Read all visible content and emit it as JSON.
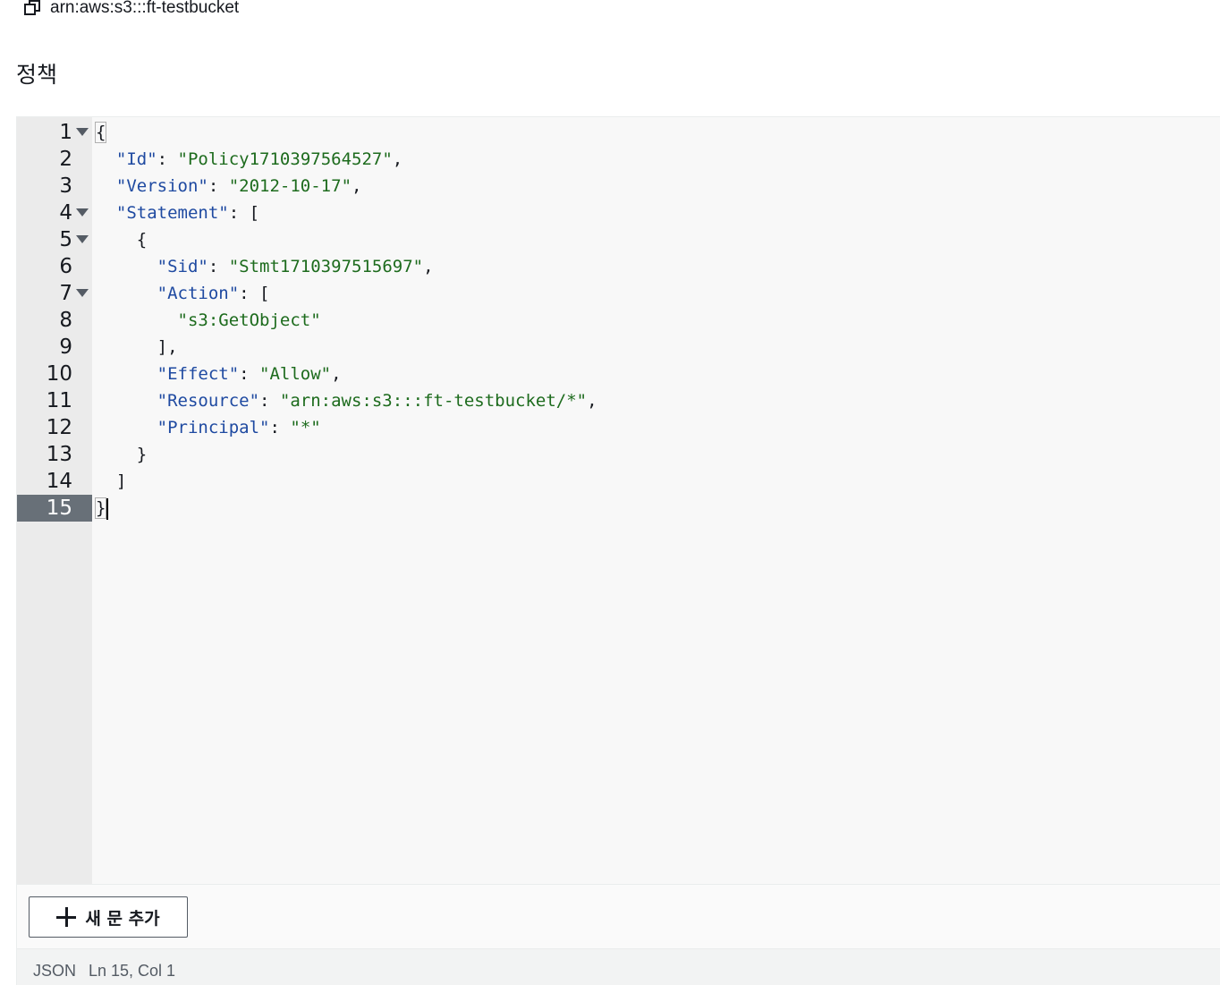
{
  "header": {
    "arn": "arn:aws:s3:::ft-testbucket",
    "copy_icon": "copy-icon"
  },
  "section": {
    "title": "정책"
  },
  "editor": {
    "active_line": 15,
    "fold_lines": [
      1,
      4,
      5,
      7
    ],
    "lines": [
      {
        "n": "1",
        "tokens": [
          {
            "t": "p",
            "v": "{"
          }
        ]
      },
      {
        "n": "2",
        "tokens": [
          {
            "t": "p",
            "v": "  "
          },
          {
            "t": "k",
            "v": "\"Id\""
          },
          {
            "t": "p",
            "v": ": "
          },
          {
            "t": "s",
            "v": "\"Policy1710397564527\""
          },
          {
            "t": "p",
            "v": ","
          }
        ]
      },
      {
        "n": "3",
        "tokens": [
          {
            "t": "p",
            "v": "  "
          },
          {
            "t": "k",
            "v": "\"Version\""
          },
          {
            "t": "p",
            "v": ": "
          },
          {
            "t": "s",
            "v": "\"2012-10-17\""
          },
          {
            "t": "p",
            "v": ","
          }
        ]
      },
      {
        "n": "4",
        "tokens": [
          {
            "t": "p",
            "v": "  "
          },
          {
            "t": "k",
            "v": "\"Statement\""
          },
          {
            "t": "p",
            "v": ": ["
          }
        ]
      },
      {
        "n": "5",
        "tokens": [
          {
            "t": "p",
            "v": "    {"
          }
        ]
      },
      {
        "n": "6",
        "tokens": [
          {
            "t": "p",
            "v": "      "
          },
          {
            "t": "k",
            "v": "\"Sid\""
          },
          {
            "t": "p",
            "v": ": "
          },
          {
            "t": "s",
            "v": "\"Stmt1710397515697\""
          },
          {
            "t": "p",
            "v": ","
          }
        ]
      },
      {
        "n": "7",
        "tokens": [
          {
            "t": "p",
            "v": "      "
          },
          {
            "t": "k",
            "v": "\"Action\""
          },
          {
            "t": "p",
            "v": ": ["
          }
        ]
      },
      {
        "n": "8",
        "tokens": [
          {
            "t": "p",
            "v": "        "
          },
          {
            "t": "s",
            "v": "\"s3:GetObject\""
          }
        ]
      },
      {
        "n": "9",
        "tokens": [
          {
            "t": "p",
            "v": "      ],"
          }
        ]
      },
      {
        "n": "10",
        "tokens": [
          {
            "t": "p",
            "v": "      "
          },
          {
            "t": "k",
            "v": "\"Effect\""
          },
          {
            "t": "p",
            "v": ": "
          },
          {
            "t": "s",
            "v": "\"Allow\""
          },
          {
            "t": "p",
            "v": ","
          }
        ]
      },
      {
        "n": "11",
        "tokens": [
          {
            "t": "p",
            "v": "      "
          },
          {
            "t": "k",
            "v": "\"Resource\""
          },
          {
            "t": "p",
            "v": ": "
          },
          {
            "t": "s",
            "v": "\"arn:aws:s3:::ft-testbucket/*\""
          },
          {
            "t": "p",
            "v": ","
          }
        ]
      },
      {
        "n": "12",
        "tokens": [
          {
            "t": "p",
            "v": "      "
          },
          {
            "t": "k",
            "v": "\"Principal\""
          },
          {
            "t": "p",
            "v": ": "
          },
          {
            "t": "s",
            "v": "\"*\""
          }
        ]
      },
      {
        "n": "13",
        "tokens": [
          {
            "t": "p",
            "v": "    }"
          }
        ]
      },
      {
        "n": "14",
        "tokens": [
          {
            "t": "p",
            "v": "  ]"
          }
        ]
      },
      {
        "n": "15",
        "tokens": [
          {
            "t": "p",
            "v": "}"
          }
        ]
      }
    ]
  },
  "toolbar": {
    "add_statement_label": "새 문 추가",
    "add_icon": "plus-icon"
  },
  "status": {
    "language": "JSON",
    "position": "Ln 15, Col 1"
  },
  "colors": {
    "key": "#1f4aa1",
    "string": "#1d6b1d",
    "active_gutter": "#687078",
    "gutter": "#ebebeb",
    "editor_bg": "#f8f8f8"
  }
}
